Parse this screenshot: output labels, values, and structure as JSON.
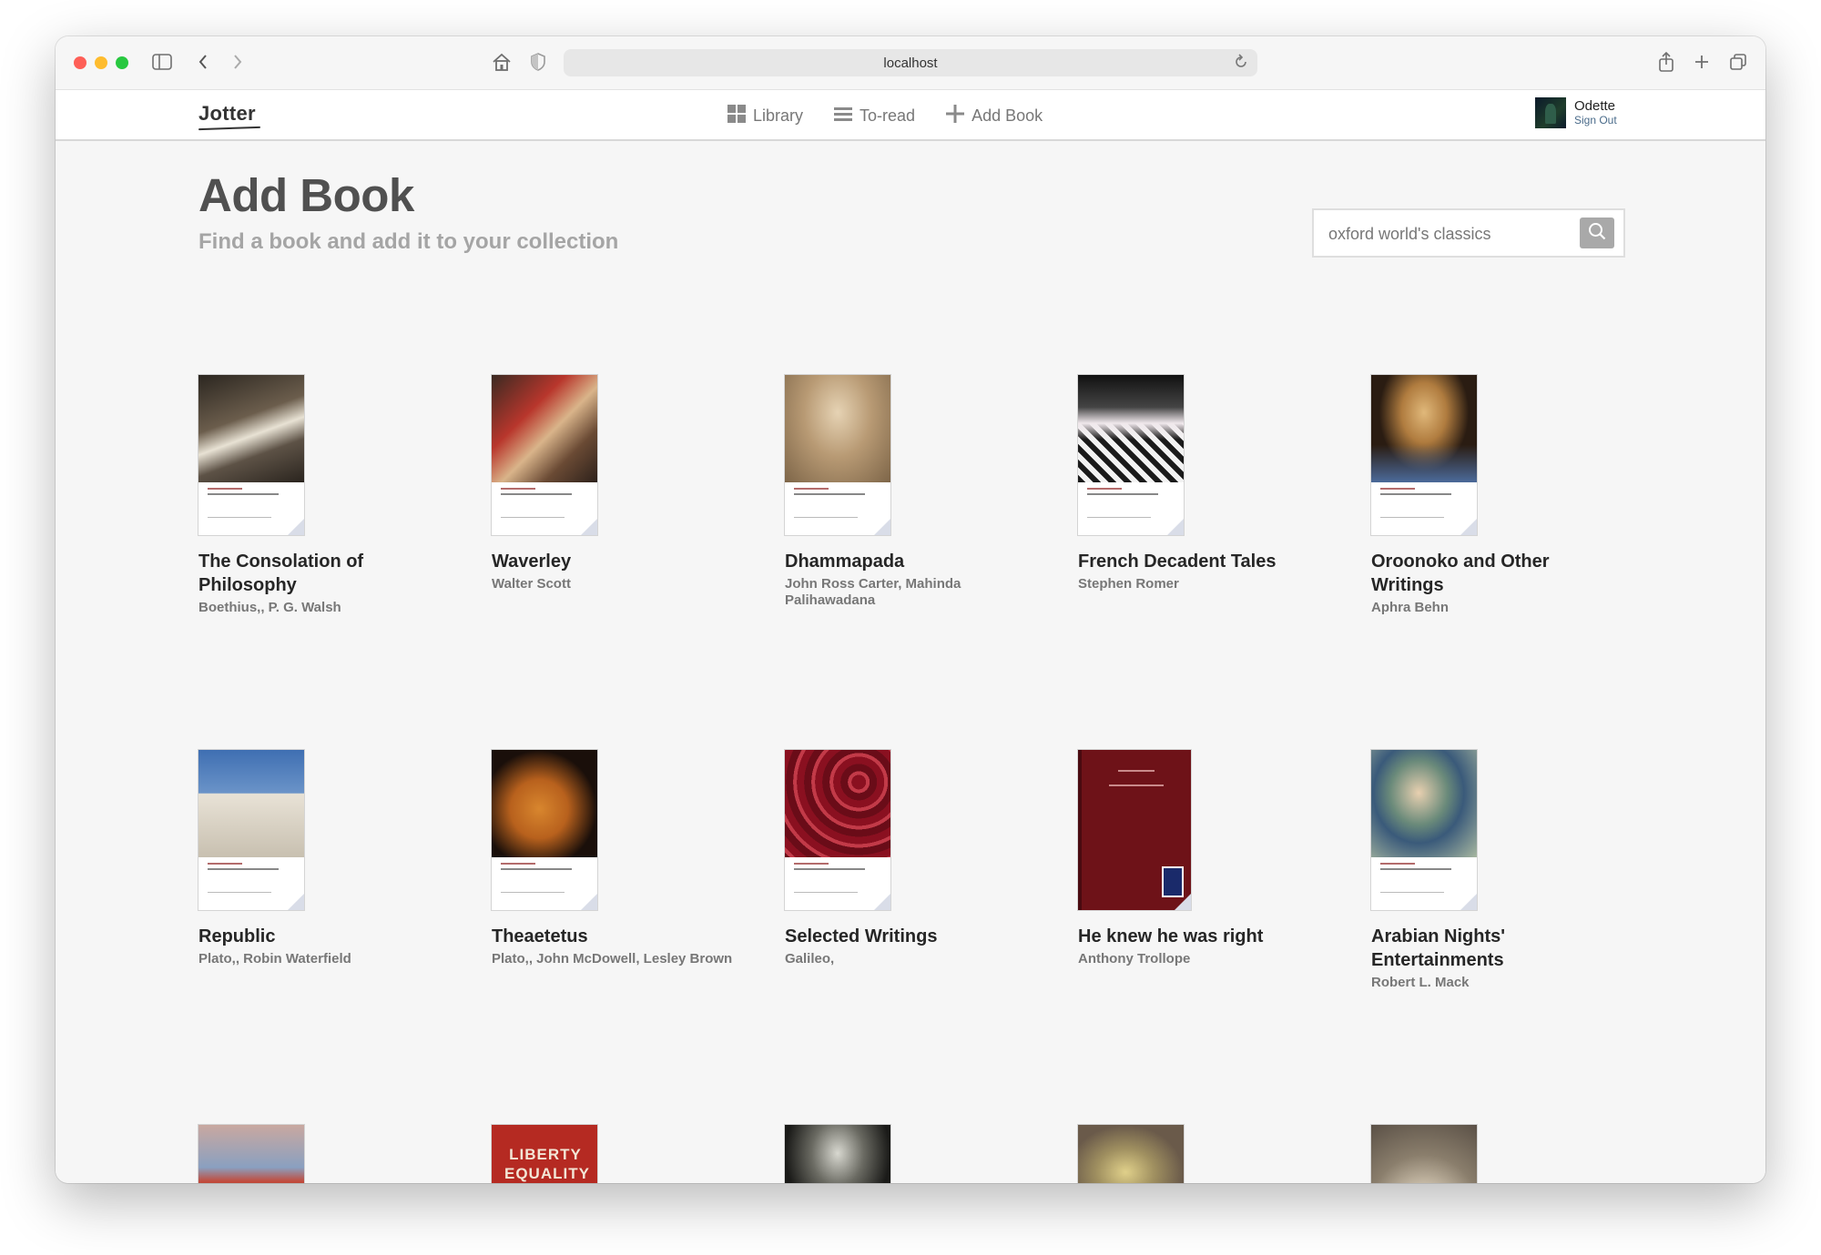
{
  "browser": {
    "url": "localhost"
  },
  "nav": {
    "logo": "Jotter",
    "links": [
      {
        "label": "Library",
        "icon": "grid-icon"
      },
      {
        "label": "To-read",
        "icon": "list-icon"
      },
      {
        "label": "Add Book",
        "icon": "plus-icon"
      }
    ],
    "user": {
      "name": "Odette",
      "sign_out": "Sign Out"
    }
  },
  "page": {
    "title": "Add Book",
    "subtitle": "Find a book and add it to your collection"
  },
  "search": {
    "value": "oxford world's classics"
  },
  "books": [
    {
      "title": "The Consolation of Philosophy",
      "author": "Boethius,, P. G. Walsh"
    },
    {
      "title": "Waverley",
      "author": "Walter Scott"
    },
    {
      "title": "Dhammapada",
      "author": "John Ross Carter, Mahinda Palihawadana"
    },
    {
      "title": "French Decadent Tales",
      "author": "Stephen Romer"
    },
    {
      "title": "Oroonoko and Other Writings",
      "author": "Aphra Behn"
    },
    {
      "title": "Republic",
      "author": "Plato,, Robin Waterfield"
    },
    {
      "title": "Theaetetus",
      "author": "Plato,, John McDowell, Lesley Brown"
    },
    {
      "title": "Selected Writings",
      "author": "Galileo,"
    },
    {
      "title": "He knew he was right",
      "author": "Anthony Trollope"
    },
    {
      "title": "Arabian Nights' Entertainments",
      "author": "Robert L. Mack"
    }
  ],
  "partial_cover_text": "LIBERTY EQUALITY & HUMBUG ORWELL'S",
  "colors": {
    "accent": "#a9a9a9",
    "title_text": "#505050",
    "subtitle_text": "#a5a5a5"
  }
}
